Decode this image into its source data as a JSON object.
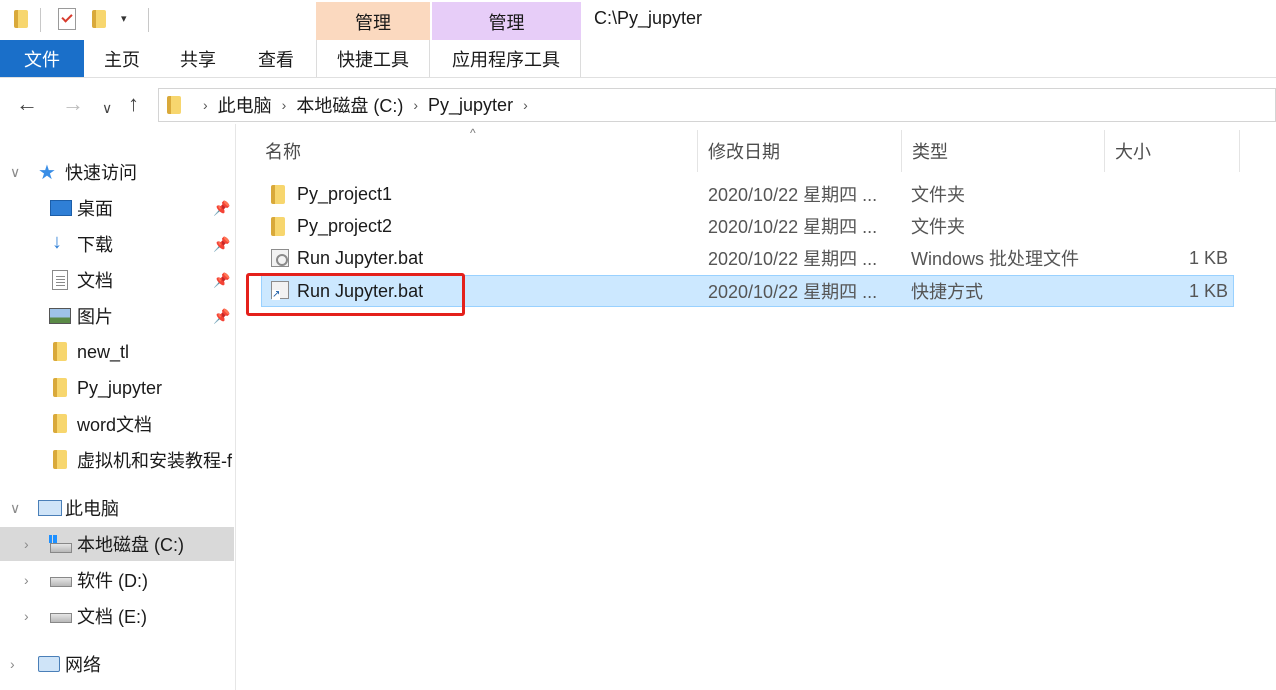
{
  "window": {
    "title_path": "C:\\Py_jupyter",
    "qat_dropdown": "▾",
    "context_tabs": [
      "管理",
      "管理"
    ]
  },
  "ribbon": {
    "tabs": [
      "文件",
      "主页",
      "共享",
      "查看",
      "快捷工具",
      "应用程序工具"
    ]
  },
  "address": {
    "back": "←",
    "forward": "→",
    "recent": "∨",
    "up": "↑",
    "separator": "›",
    "crumbs": [
      "此电脑",
      "本地磁盘 (C:)",
      "Py_jupyter"
    ]
  },
  "sidebar": {
    "quick_access": {
      "label": "快速访问",
      "chevron": "∨",
      "icon": "star-icon"
    },
    "pinned": [
      {
        "label": "桌面",
        "icon": "desktop-icon"
      },
      {
        "label": "下载",
        "icon": "download-icon"
      },
      {
        "label": "文档",
        "icon": "document-icon"
      },
      {
        "label": "图片",
        "icon": "pictures-icon"
      }
    ],
    "pin_glyph": "📌",
    "folders": [
      "new_tl",
      "Py_jupyter",
      "word文档",
      "虚拟机和安装教程-f"
    ],
    "this_pc": {
      "label": "此电脑",
      "chevron": "∨"
    },
    "drives": [
      {
        "label": "本地磁盘 (C:)",
        "chevron": "›",
        "selected": true
      },
      {
        "label": "软件 (D:)",
        "chevron": "›",
        "selected": false
      },
      {
        "label": "文档 (E:)",
        "chevron": "›",
        "selected": false
      }
    ],
    "network": {
      "label": "网络",
      "chevron": "›"
    }
  },
  "file_list": {
    "sort_indicator": "^",
    "columns": [
      "名称",
      "修改日期",
      "类型",
      "大小"
    ],
    "rows": [
      {
        "name": "Py_project1",
        "date": "2020/10/22 星期四 ...",
        "type": "文件夹",
        "size": "",
        "icon": "folder-icon",
        "selected": false
      },
      {
        "name": "Py_project2",
        "date": "2020/10/22 星期四 ...",
        "type": "文件夹",
        "size": "",
        "icon": "folder-icon",
        "selected": false
      },
      {
        "name": "Run Jupyter.bat",
        "date": "2020/10/22 星期四 ...",
        "type": "Windows 批处理文件",
        "size": "1 KB",
        "icon": "batch-file-icon",
        "selected": false
      },
      {
        "name": "Run Jupyter.bat",
        "date": "2020/10/22 星期四 ...",
        "type": "快捷方式",
        "size": "1 KB",
        "icon": "shortcut-icon",
        "selected": true
      }
    ]
  },
  "colors": {
    "file_tab": "#1a6fc9",
    "manage_orange": "#fbd9bf",
    "manage_purple": "#e7cdf8",
    "selection": "#cce8ff",
    "highlight_border": "#e4201b"
  }
}
